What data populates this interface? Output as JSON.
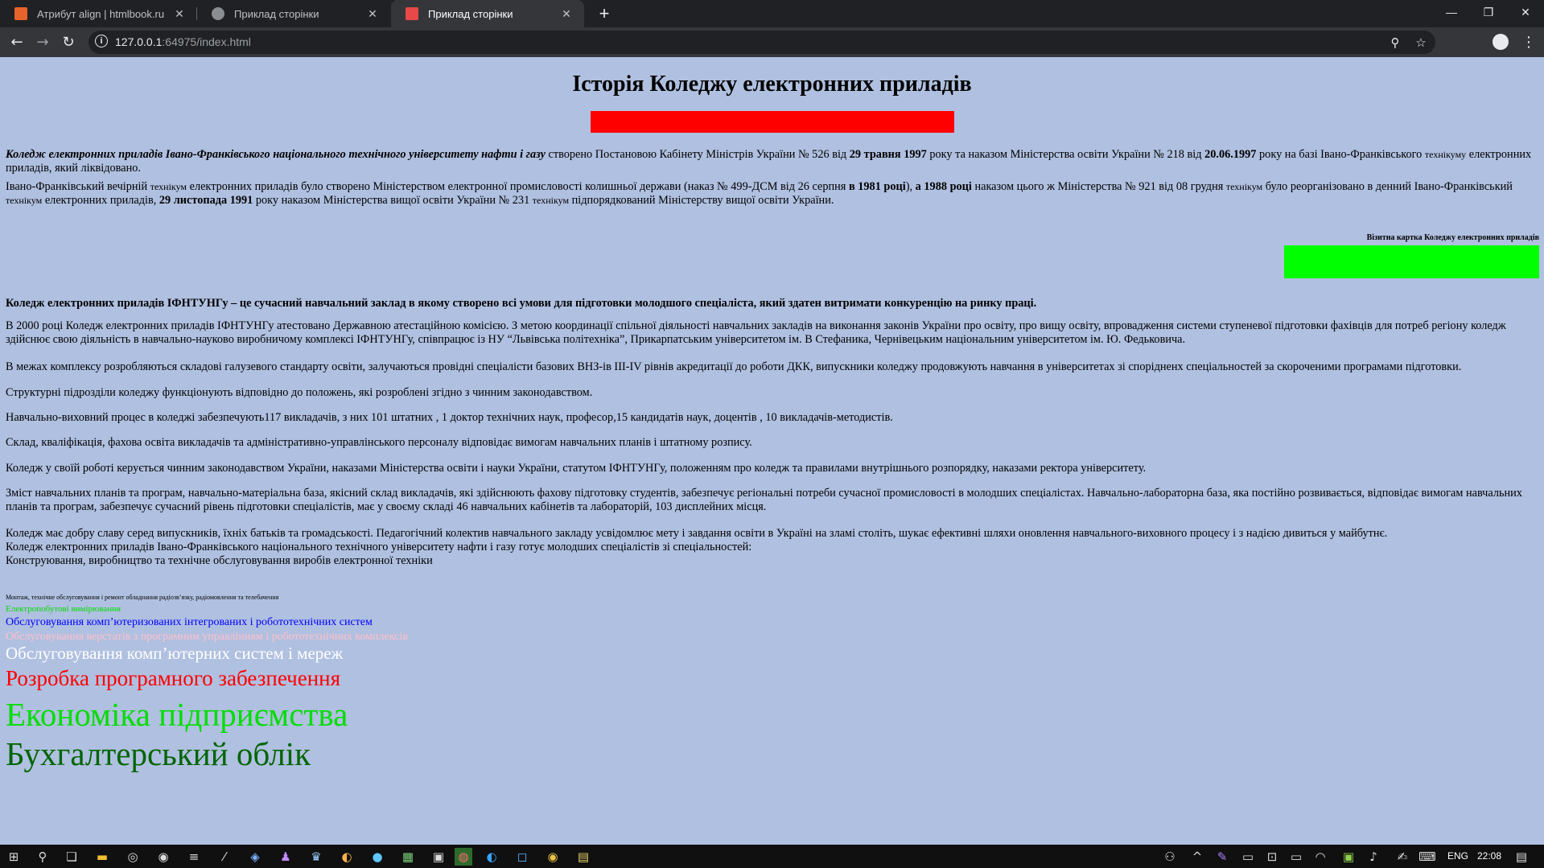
{
  "browser": {
    "tabs": [
      {
        "title": "Атрибут align | htmlbook.ru",
        "favicon_color": "#e8632b"
      },
      {
        "title": "Приклад сторінки",
        "favicon_color": "#8a8d91"
      },
      {
        "title": "Приклад сторінки",
        "favicon_color": "#e84848"
      }
    ],
    "url_host": "127.0.0.1",
    "url_rest": ":64975/index.html",
    "icons": {
      "back": "back-arrow-icon",
      "forward": "forward-arrow-icon",
      "reload": "reload-icon",
      "zoom": "zoom-icon",
      "bookmark": "star-icon",
      "profile": "profile-icon",
      "menu": "kebab-menu-icon"
    }
  },
  "page": {
    "title": "Історія Коледжу електронних приладів",
    "p1": {
      "lead": "Коледж електронних приладів Івано-Франківського національного технічного університету нафти і газу",
      "a": " створено Постановою Кабінету Міністрів України № 526 від ",
      "d1": "29 травня 1997",
      "b": " року та наказом Міністерства освіти України № 218 від ",
      "d2": "20.06.1997",
      "c": " року на базі Івано-Франківського ",
      "s1": "технікуму",
      "e": " електронних приладів, який ліквідовано."
    },
    "p2": {
      "a": "Івано-Франківський вечірній ",
      "s1": "технікум",
      "b": " електронних приладів було створено Міністерством електронної промисловості колишньої держави (наказ № 499-ДСМ від 26 серпня ",
      "d1": "в 1981 році",
      "c": "), ",
      "d2": "а 1988 році",
      "e": " наказом цього ж Міністерства № 921 від 08 грудня ",
      "s2": "технікум",
      "f": " було реорганізовано в денний Івано-Франківський ",
      "s3": "технікум",
      "g": " електронних приладів, ",
      "d3": "29 листопада 1991",
      "h": " року наказом Міністерства вищої освіти України № 231 ",
      "s4": "технікум",
      "i": " підпорядкований Міністерству вищої освіти України."
    },
    "card_label": "Візитна картка Коледжу електронних приладів",
    "bold_p": "Коледж електронних приладів ІФНТУНГу – це сучасний навчальний заклад в якому створено всі умови для підготовки молодшого спеціаліста, який здатен витримати конкуренцію на ринку праці.",
    "paragraphs": [
      "В 2000 році Коледж електронних приладів ІФНТУНГу атестовано Державною атестаційною комісією. З метою координації спільної діяльності навчальних закладів на виконання законів України про освіту, про вищу освіту, впровадження системи ступеневої підготовки фахівців для потреб регіону коледж здійснює свою діяльність в навчально-науково виробничому комплексі ІФНТУНГу, співпрацює із НУ “Львівська політехніка”, Прикарпатським університетом ім. В Стефаника, Чернівецьким національним університетом ім. Ю. Федьковича.",
      "В межах комплексу розробляються складові галузевого стандарту освіти, залучаються провідні спеціалісти базових ВНЗ-ів ІІІ-IV рівнів акредитації до роботи ДКК, випускники коледжу продовжують навчання в університетах зі спорідненх спеціальностей за скороченими програмами підготовки.",
      "Структурні підрозділи коледжу функціонують відповідно до положень, які розроблені згідно з чинним законодавством.",
      "Навчально-виховний процес в коледжі забезпечують117 викладачів, з них 101 штатних , 1 доктор технічних наук, професор,15 кандидатів наук, доцентів , 10 викладачів-методистів.",
      "Склад, кваліфікація, фахова освіта викладачів та адміністративно-управлінського персоналу відповідає вимогам навчальних планів і штатному розпису.",
      "Коледж у своїй роботі керується чинним законодавством України, наказами Міністерства освіти і науки України, статутом ІФНТУНГу, положенням про коледж та правилами внутрішнього розпорядку, наказами ректора університету.",
      "Зміст навчальних планів та програм, навчально-матеріальна база, якісний склад викладачів, які здійснюють фахову підготовку студентів, забезпечує регіональні потреби сучасної промисловості в молодших спеціалістах. Навчально-лабораторна база, яка постійно розвивається, відповідає вимогам навчальних планів та програм, забезпечує сучасний рівень підготовки спеціалістів, має у своєму складі 46 навчальних кабінетів та лабораторій, 103 дисплейних місця."
    ],
    "last_lines": [
      "Коледж має добру славу серед випускників, їхніх батьків та громадськості. Педагогічний колектив навчального закладу усвідомлює мету і завдання освіти в Україні на зламі століть, шукає ефективні шляхи оновлення навчального-виховного процесу і з надією дивиться у майбутнє.",
      "Коледж електронних приладів Івано-Франківського національного технічного університету нафти і газу готує молодших спеціалістів зі спеціальностей:",
      "Конструювання, виробництво та технічне обслуговування виробів електронної техніки"
    ],
    "specialties": [
      {
        "text": "Монтаж, технічне обслуговування і ремонт обладнання радіозв’язку, радіомовлення та телебачення",
        "color": "#000000"
      },
      {
        "text": "Електропобутові вимірювання",
        "color": "#00dd00"
      },
      {
        "text": "Обслуговування комп’ютеризованих інтегрованих і робототехнічних систем",
        "color": "#0000ff"
      },
      {
        "text": "Обслуговування верстатів з програмним управлінням і робототехнічних комплексів",
        "color": "#ffc0cb"
      },
      {
        "text": "Обслуговування комп’ютерних систем і мереж",
        "color": "#ffffff"
      },
      {
        "text": "Розробка програмного забезпечення",
        "color": "#ff0000"
      },
      {
        "text": "Економіка підприємства",
        "color": "#00dd00"
      },
      {
        "text": "Бухгалтерський облік",
        "color": "#006400"
      }
    ],
    "colors": {
      "background": "#b0c0e0",
      "red_bar": "#ff0000",
      "green_bar": "#00ff00"
    }
  },
  "taskbar": {
    "lang": "ENG",
    "time": "22:08"
  }
}
